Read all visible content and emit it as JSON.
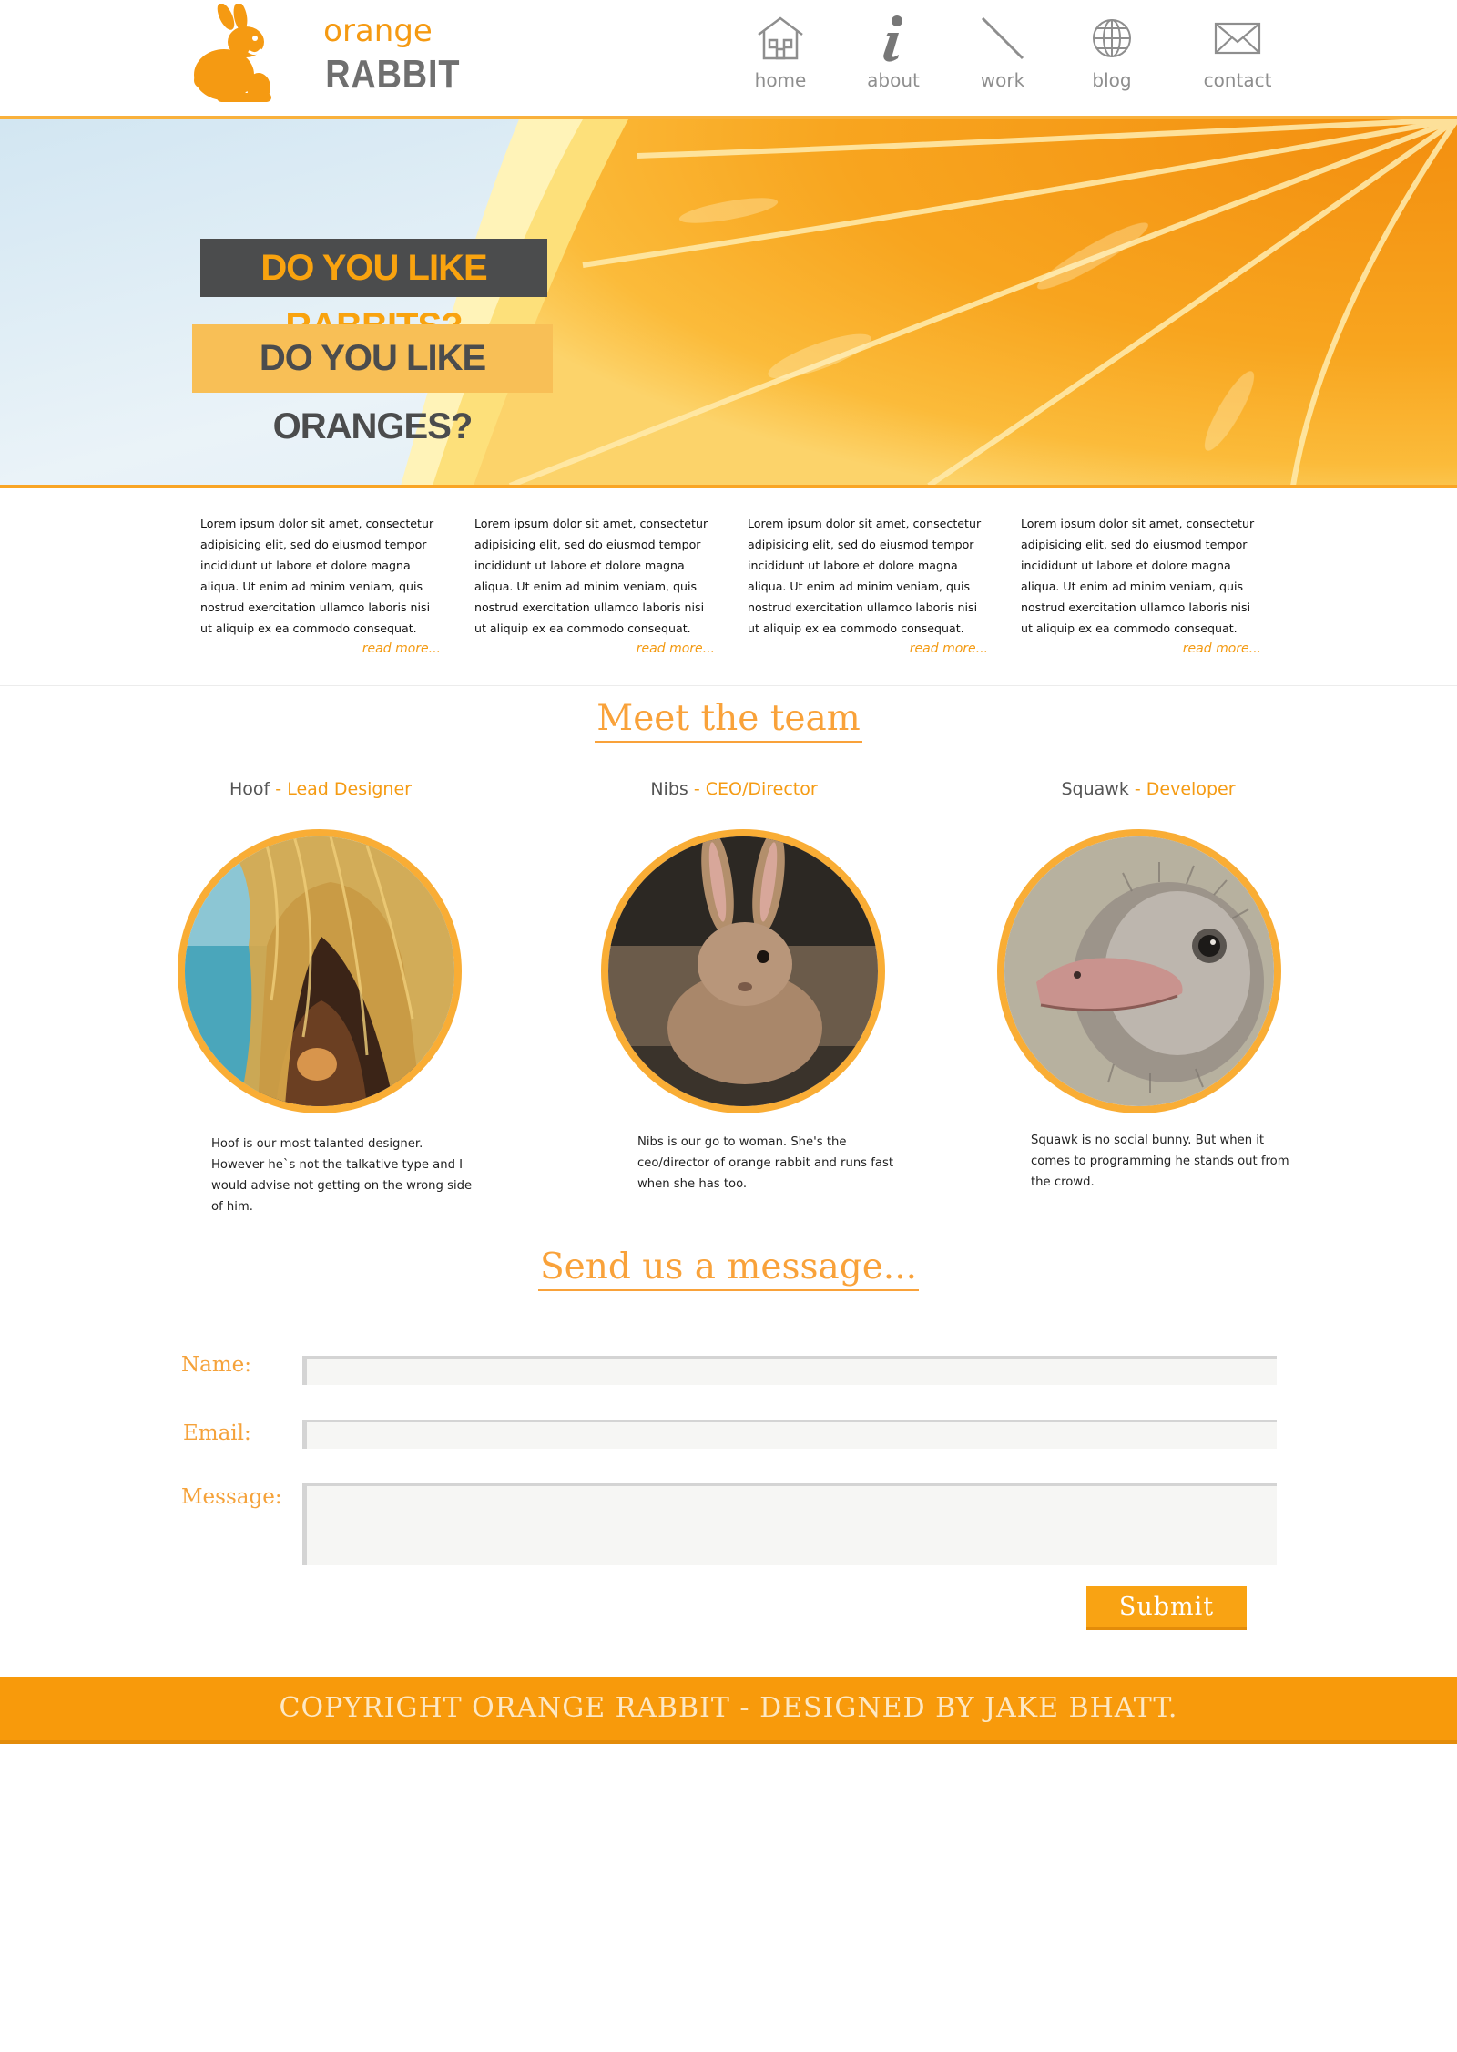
{
  "brand": {
    "top": "orange",
    "bottom": "RABBIT"
  },
  "nav": [
    {
      "label": "home",
      "icon": "house-icon"
    },
    {
      "label": "about",
      "icon": "info-icon"
    },
    {
      "label": "work",
      "icon": "pen-icon"
    },
    {
      "label": "blog",
      "icon": "globe-icon"
    },
    {
      "label": "contact",
      "icon": "envelope-icon"
    }
  ],
  "hero": {
    "line1": "DO YOU LIKE RABBITS?",
    "line2": "DO YOU LIKE ORANGES?"
  },
  "columns": [
    {
      "text": "Lorem ipsum dolor sit amet, consectetur adipisicing elit, sed do eiusmod tempor incididunt ut labore et dolore magna aliqua. Ut enim ad minim veniam, quis nostrud exercitation ullamco laboris nisi ut aliquip ex ea commodo consequat.",
      "more": "read more..."
    },
    {
      "text": "Lorem ipsum dolor sit amet, consectetur adipisicing elit, sed do eiusmod tempor incididunt ut labore et dolore magna aliqua. Ut enim ad minim veniam, quis nostrud exercitation ullamco laboris nisi ut aliquip ex ea commodo consequat.",
      "more": "read more..."
    },
    {
      "text": "Lorem ipsum dolor sit amet, consectetur adipisicing elit, sed do eiusmod tempor incididunt ut labore et dolore magna aliqua. Ut enim ad minim veniam, quis nostrud exercitation ullamco laboris nisi ut aliquip ex ea commodo consequat.",
      "more": "read more..."
    },
    {
      "text": "Lorem ipsum dolor sit amet, consectetur adipisicing elit, sed do eiusmod tempor incididunt ut labore et dolore magna aliqua. Ut enim ad minim veniam, quis nostrud exercitation ullamco laboris nisi ut aliquip ex ea commodo consequat.",
      "more": "read more..."
    }
  ],
  "team": {
    "title": "Meet the team",
    "members": [
      {
        "name": "Hoof",
        "separator": " - ",
        "role": "Lead Designer",
        "bio": "Hoof is our most talanted designer. However he`s not the talkative type and I would advise not getting on the wrong side of him."
      },
      {
        "name": "Nibs",
        "separator": " - ",
        "role": "CEO/Director",
        "bio": "Nibs is our go to woman. She's the ceo/director of orange rabbit and runs fast when she has too."
      },
      {
        "name": "Squawk",
        "separator": " - ",
        "role": "Developer",
        "bio": "Squawk is no social bunny. But when it comes to programming he stands out from the crowd."
      }
    ]
  },
  "contact": {
    "title": "Send us a message...",
    "name_label": "Name:",
    "email_label": "Email:",
    "message_label": "Message:",
    "name_value": "",
    "email_value": "",
    "message_value": "",
    "submit_label": "Submit"
  },
  "footer": {
    "text": "COPYRIGHT ORANGE RABBIT - DESIGNED BY JAKE BHATT."
  },
  "colors": {
    "accent": "#f9a313",
    "accent_text": "#f59b13",
    "dark": "#4b4c4d",
    "nav_gray": "#8e8e8e"
  }
}
